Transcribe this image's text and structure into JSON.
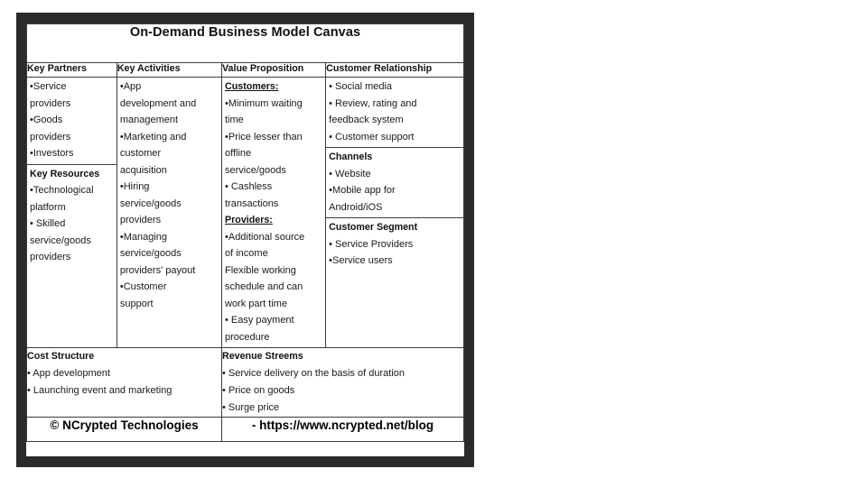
{
  "canvas": {
    "title": "On-Demand Business Model Canvas",
    "columns": [
      {
        "header": "Key Partners"
      },
      {
        "header": "Key Activities"
      },
      {
        "header": "Value Proposition"
      },
      {
        "header": "Customer Relationship"
      }
    ],
    "col1": {
      "key_partners": {
        "items": [
          "•Service",
          "providers",
          "•Goods",
          "providers",
          "•Investors"
        ]
      },
      "key_resources": {
        "title": "Key Resources",
        "items": [
          "•Technological",
          "platform",
          "• Skilled",
          "service/goods",
          "providers"
        ]
      }
    },
    "col2": {
      "key_activities": {
        "items": [
          "•App",
          "development and",
          "management",
          "•Marketing and",
          "customer",
          "acquisition",
          "•Hiring",
          "service/goods",
          "providers",
          "•Managing",
          "service/goods",
          "providers' payout",
          "•Customer",
          "support"
        ]
      }
    },
    "col3": {
      "customers": {
        "title": "Customers:",
        "items": [
          "•Minimum waiting",
          "time",
          "•Price lesser than",
          "offline",
          "service/goods",
          "• Cashless",
          "transactions"
        ]
      },
      "providers": {
        "title": "Providers:",
        "items": [
          "•Additional source",
          "of income",
          "Flexible working",
          "schedule and can",
          "work part time",
          "• Easy payment",
          "procedure"
        ]
      }
    },
    "col4": {
      "customer_relationship": {
        "items": [
          "• Social media",
          "• Review, rating and",
          "feedback system",
          "• Customer support"
        ]
      },
      "channels": {
        "title": "Channels",
        "items": [
          "• Website",
          "•Mobile app for",
          "Android/iOS"
        ]
      },
      "customer_segment": {
        "title": "Customer Segment",
        "items": [
          "• Service Providers",
          "•Service users"
        ]
      }
    },
    "cost_structure": {
      "title": "Cost Structure",
      "items": [
        "• App development",
        "• Launching event and marketing"
      ]
    },
    "revenue_streams": {
      "title": "Revenue Streems",
      "items": [
        "• Service delivery on the basis of duration",
        "• Price on goods",
        "• Surge price"
      ]
    },
    "footer": {
      "copyright": "© NCrypted Technologies",
      "url": "- https://www.ncrypted.net/blog"
    },
    "colors": {
      "frame": "#2b2b2b",
      "sheet": "#ffffff",
      "rule": "#3c3c3c",
      "text": "#1a1a1a"
    }
  }
}
